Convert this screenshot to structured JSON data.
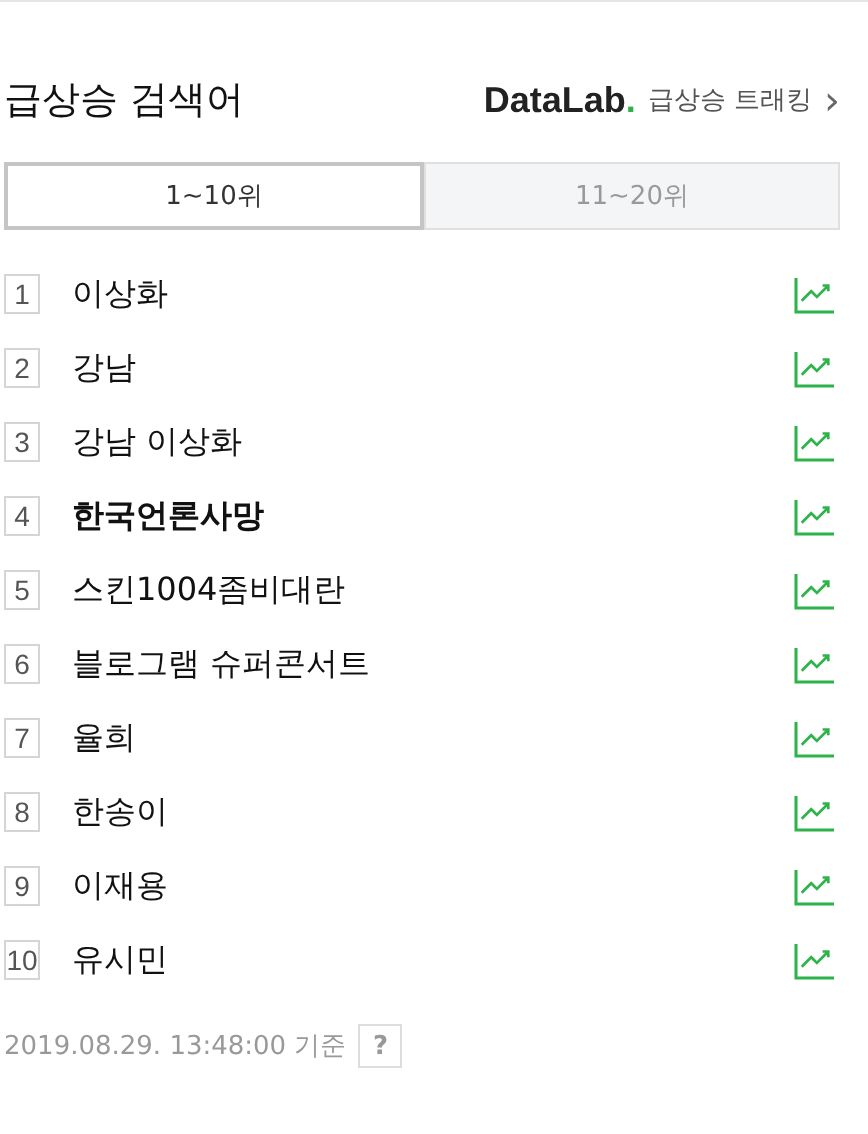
{
  "header": {
    "title": "급상승 검색어",
    "brand": "DataLab",
    "brand_dot": ".",
    "link": "급상승 트래킹",
    "chevron": "›"
  },
  "tabs": [
    {
      "label": "1~10위",
      "selected": true
    },
    {
      "label": "11~20위",
      "selected": false
    }
  ],
  "keywords": [
    {
      "rank": "1",
      "text": "이상화",
      "bold": false
    },
    {
      "rank": "2",
      "text": "강남",
      "bold": false
    },
    {
      "rank": "3",
      "text": "강남 이상화",
      "bold": false
    },
    {
      "rank": "4",
      "text": "한국언론사망",
      "bold": true
    },
    {
      "rank": "5",
      "text": "스킨1004좀비대란",
      "bold": false
    },
    {
      "rank": "6",
      "text": "블로그램 슈퍼콘서트",
      "bold": false
    },
    {
      "rank": "7",
      "text": "율희",
      "bold": false
    },
    {
      "rank": "8",
      "text": "한송이",
      "bold": false
    },
    {
      "rank": "9",
      "text": "이재용",
      "bold": false
    },
    {
      "rank": "10",
      "text": "유시민",
      "bold": false
    }
  ],
  "footer": {
    "timestamp": "2019.08.29. 13:48:00 기준",
    "help": "?"
  }
}
